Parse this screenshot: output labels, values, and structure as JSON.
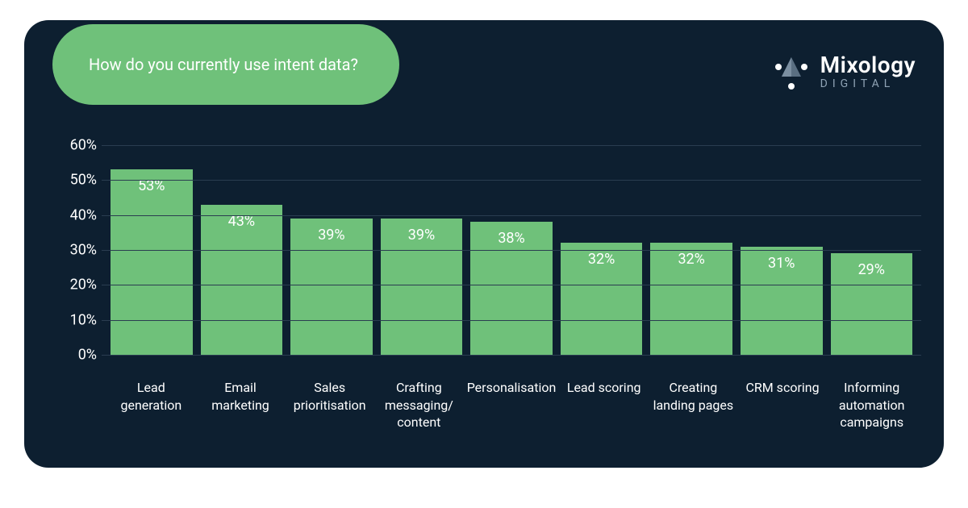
{
  "title": "How do you currently use intent data?",
  "brand": {
    "name": "Mixology",
    "sub": "DIGITAL"
  },
  "chart_data": {
    "type": "bar",
    "title": "How do you currently use intent data?",
    "xlabel": "",
    "ylabel": "",
    "ylim": [
      0,
      60
    ],
    "yticks": [
      0,
      10,
      20,
      30,
      40,
      50,
      60
    ],
    "categories": [
      "Lead\ngeneration",
      "Email\nmarketing",
      "Sales\nprioritisation",
      "Crafting\nmessaging/\ncontent",
      "Personalisation",
      "Lead scoring",
      "Creating\nlanding pages",
      "CRM scoring",
      "Informing\nautomation\ncampaigns"
    ],
    "values": [
      53,
      43,
      39,
      39,
      38,
      32,
      32,
      31,
      29
    ],
    "value_labels": [
      "53%",
      "43%",
      "39%",
      "39%",
      "38%",
      "32%",
      "32%",
      "31%",
      "29%"
    ],
    "ytick_labels": [
      "0%",
      "10%",
      "20%",
      "30%",
      "40%",
      "50%",
      "60%"
    ],
    "bar_color": "#6fc17a",
    "background": "#0d1f30"
  }
}
